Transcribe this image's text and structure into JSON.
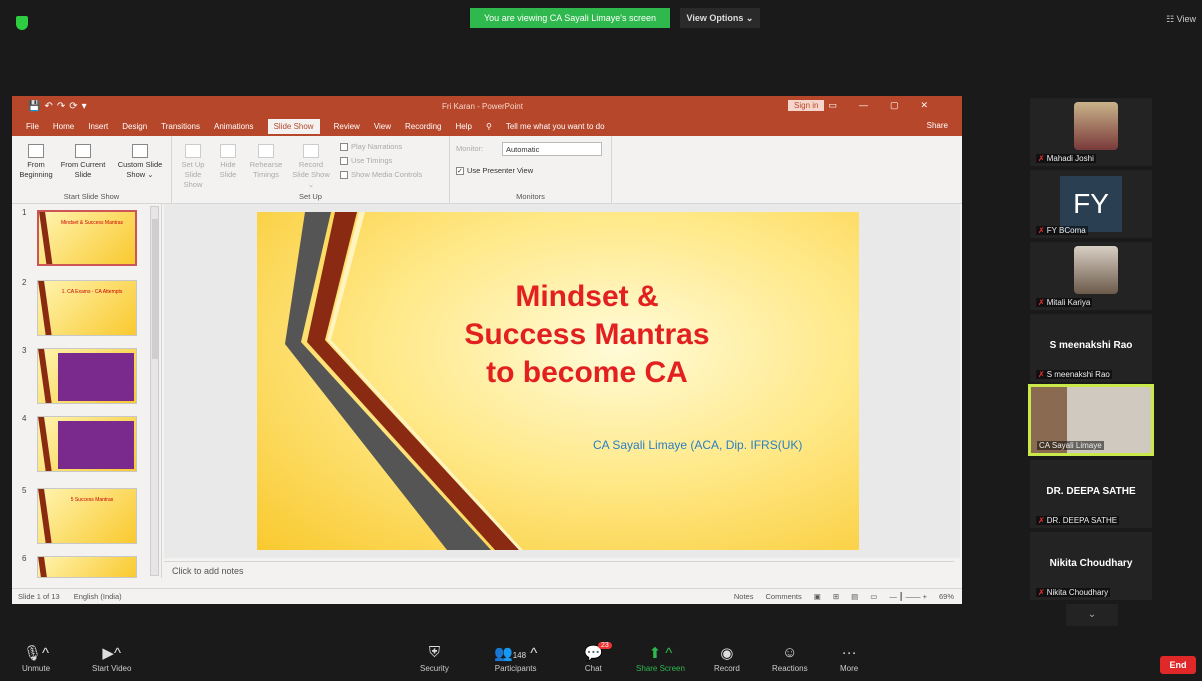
{
  "banner": {
    "viewing": "You are viewing CA Sayali Limaye's screen",
    "view_options": "View Options ⌄",
    "view_btn": "☷ View"
  },
  "ppt": {
    "window_title": "Fri Karan - PowerPoint",
    "sign_in": "Sign in",
    "menu": [
      "File",
      "Home",
      "Insert",
      "Design",
      "Transitions",
      "Animations",
      "Slide Show",
      "Review",
      "View",
      "Recording",
      "Help"
    ],
    "active_tab": "Slide Show",
    "tell_me": "Tell me what you want to do",
    "share": "Share",
    "ribbon": {
      "from_beginning": "From Beginning",
      "from_current": "From Current Slide",
      "custom_show": "Custom Slide Show ⌄",
      "group_start": "Start Slide Show",
      "set_up": "Set Up Slide Show",
      "hide_slide": "Hide Slide",
      "rehearse": "Rehearse Timings",
      "record": "Record Slide Show ⌄",
      "play_narrations": "Play Narrations",
      "use_timings": "Use Timings",
      "show_media": "Show Media Controls",
      "group_setup": "Set Up",
      "monitor_label": "Monitor:",
      "monitor_value": "Automatic",
      "presenter_view": "Use Presenter View",
      "group_monitors": "Monitors"
    },
    "thumbnails": [
      {
        "num": "1",
        "title": "Mindset & Success Mantras"
      },
      {
        "num": "2",
        "title": "1. CA Exams - CA Attempts"
      },
      {
        "num": "3",
        "title": ""
      },
      {
        "num": "4",
        "title": ""
      },
      {
        "num": "5",
        "title": "5 Success Mantras"
      },
      {
        "num": "6",
        "title": ""
      }
    ],
    "slide": {
      "title": "Mindset &\nSuccess Mantras\nto become CA",
      "subtitle": "CA Sayali Limaye (ACA, Dip. IFRS(UK)"
    },
    "notes_placeholder": "Click to add notes",
    "status": {
      "slide_of": "Slide 1 of 13",
      "language": "English (India)",
      "notes": "Notes",
      "comments": "Comments",
      "zoom": "69%"
    }
  },
  "participants": [
    {
      "name": "Mahadi Joshi",
      "type": "photo"
    },
    {
      "name": "FY BComa",
      "type": "initials",
      "initials": "FY"
    },
    {
      "name": "Mitali Kariya",
      "type": "photo"
    },
    {
      "name": "S meenakshi Rao",
      "type": "name",
      "big": "S meenakshi Rao"
    },
    {
      "name": "CA Sayali Limaye",
      "type": "photo",
      "active": true
    },
    {
      "name": "DR. DEEPA SATHE",
      "type": "name",
      "big": "DR. DEEPA SATHE"
    },
    {
      "name": "Nikita Choudhary",
      "type": "name",
      "big": "Nikita Choudhary"
    }
  ],
  "toolbar": {
    "unmute": "Unmute",
    "start_video": "Start Video",
    "security": "Security",
    "participants": "Participants",
    "participants_count": "148",
    "chat": "Chat",
    "chat_badge": "23",
    "share_screen": "Share Screen",
    "record": "Record",
    "reactions": "Reactions",
    "more": "More",
    "end": "End"
  }
}
